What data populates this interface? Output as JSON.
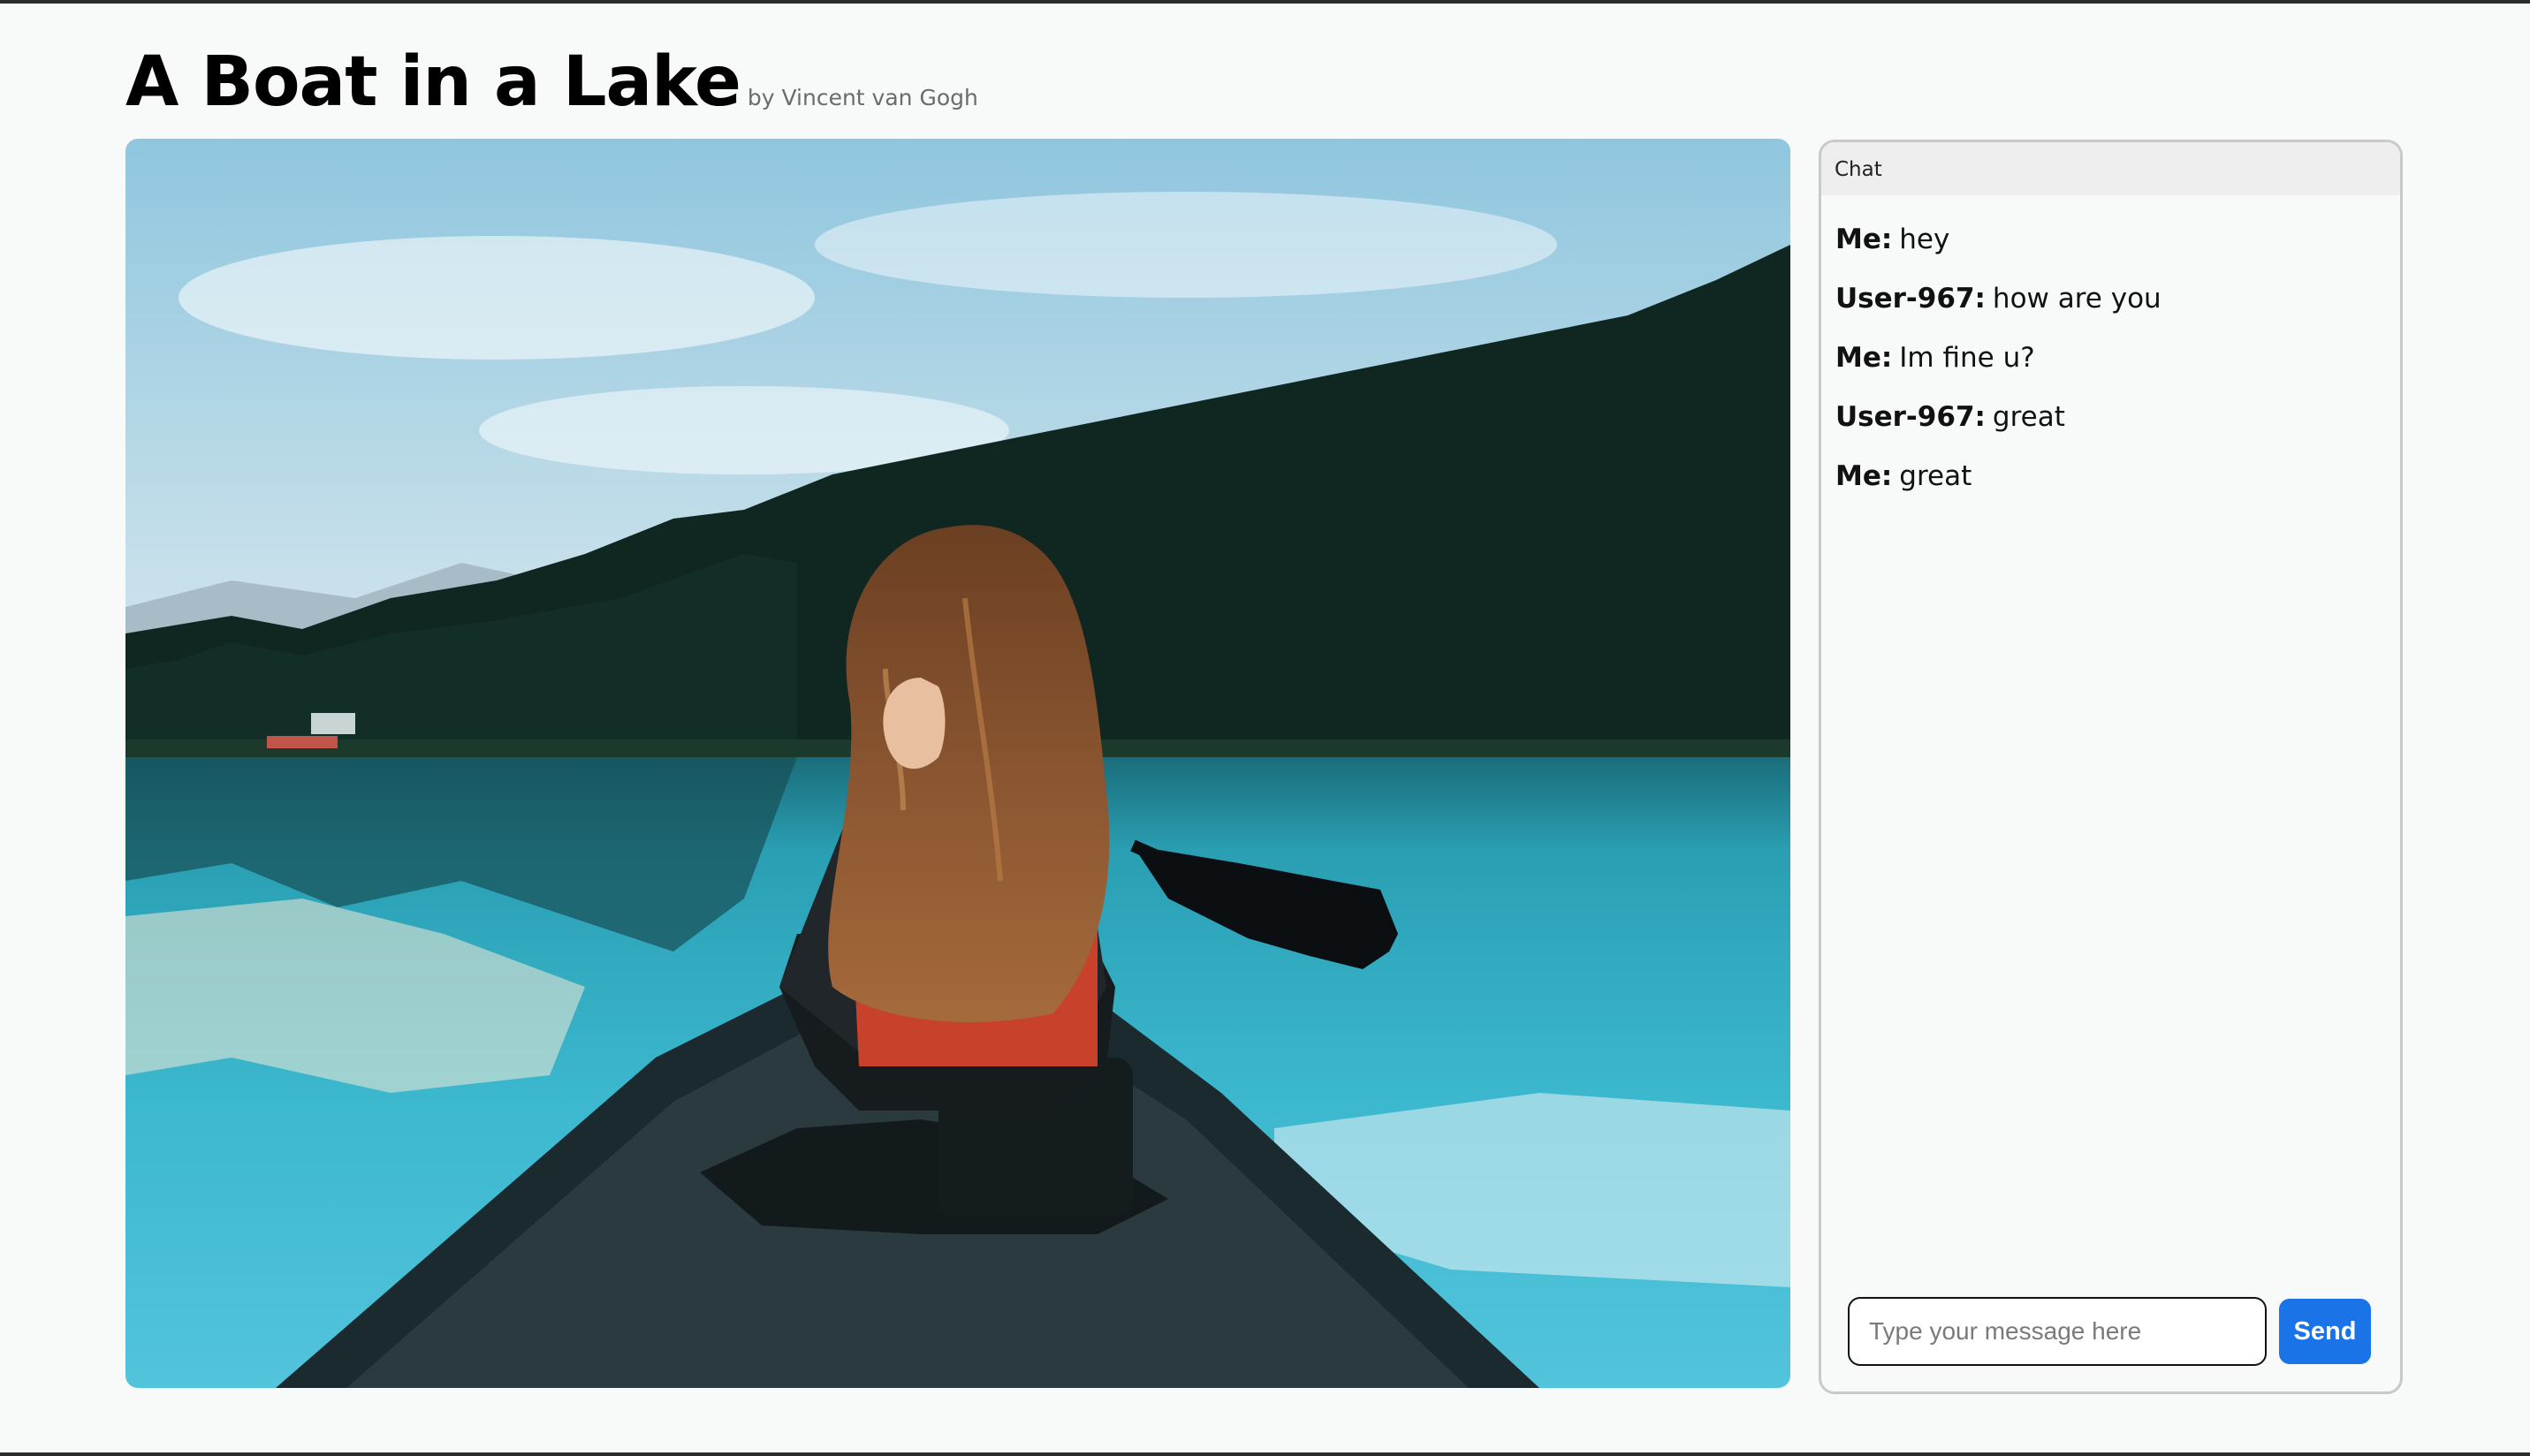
{
  "artwork": {
    "title": "A Boat in a Lake",
    "byline": "by Vincent van Gogh"
  },
  "chat": {
    "header": "Chat",
    "messages": [
      {
        "sender": "Me:",
        "text": "hey"
      },
      {
        "sender": "User-967:",
        "text": "how are you"
      },
      {
        "sender": "Me:",
        "text": "Im fine u?"
      },
      {
        "sender": "User-967:",
        "text": "great"
      },
      {
        "sender": "Me:",
        "text": "great"
      }
    ],
    "input_placeholder": "Type your message here",
    "input_value": "",
    "send_label": "Send"
  },
  "colors": {
    "accent": "#1b73e8",
    "page_background": "#f8f9f9"
  }
}
